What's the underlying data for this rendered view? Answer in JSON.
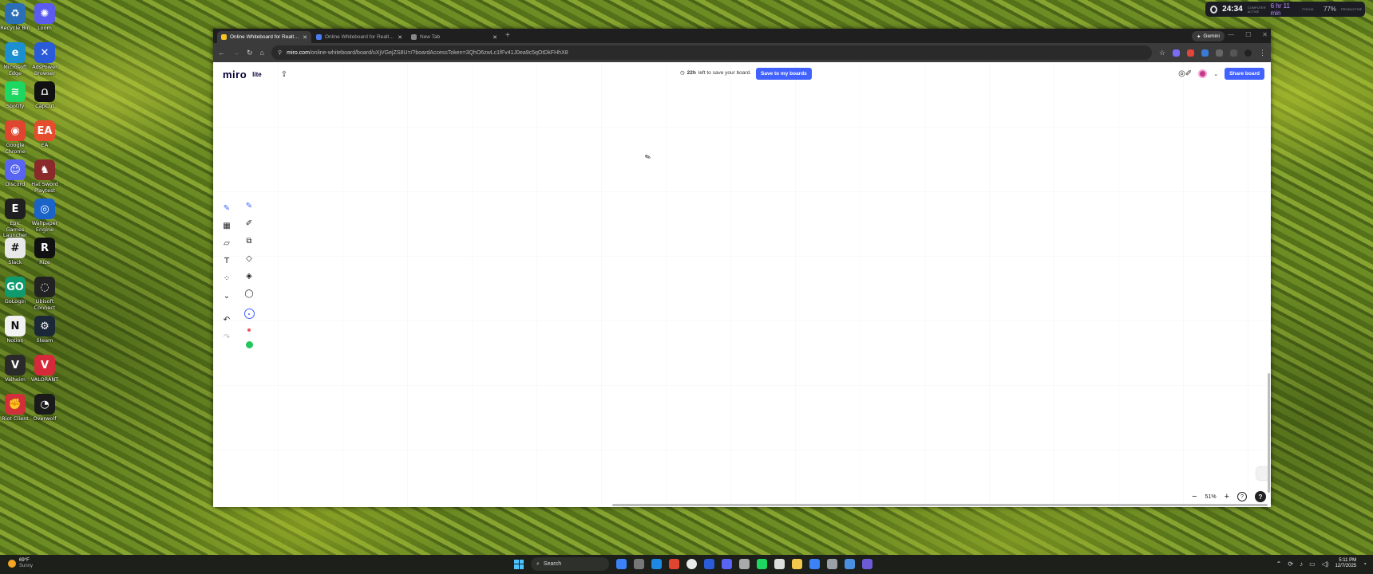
{
  "desktop": {
    "icons": [
      {
        "label": "Recycle Bin",
        "color": "#2a6fb8",
        "glyph": "♻"
      },
      {
        "label": "Loom",
        "color": "#5b5bf0",
        "glyph": "✺"
      },
      {
        "label": "Microsoft Edge",
        "color": "#1b8fd0",
        "glyph": "e"
      },
      {
        "label": "AdsPower Browser",
        "color": "#2a5bd8",
        "glyph": "✕"
      },
      {
        "label": "Spotify",
        "color": "#1ed760",
        "glyph": "≋"
      },
      {
        "label": "CapCut",
        "color": "#111111",
        "glyph": "⩍"
      },
      {
        "label": "Google Chrome",
        "color": "#e0452f",
        "glyph": "◉"
      },
      {
        "label": "EA",
        "color": "#e64d2d",
        "glyph": "EA"
      },
      {
        "label": "Discord",
        "color": "#5865f2",
        "glyph": "☺"
      },
      {
        "label": "Hat Sword Playtest",
        "color": "#8a2a2a",
        "glyph": "♞"
      },
      {
        "label": "Epic Games Launcher",
        "color": "#202020",
        "glyph": "E"
      },
      {
        "label": "Wallpaper Engine",
        "color": "#1a63c9",
        "glyph": "◎"
      },
      {
        "label": "Slack",
        "color": "#e8e8e8",
        "glyph": "#"
      },
      {
        "label": "Rize",
        "color": "#111111",
        "glyph": "R"
      },
      {
        "label": "GoLogin",
        "color": "#0f9b6e",
        "glyph": "GO"
      },
      {
        "label": "Ubisoft Connect",
        "color": "#222222",
        "glyph": "◌"
      },
      {
        "label": "Notion",
        "color": "#f2f2f2",
        "glyph": "N"
      },
      {
        "label": "Steam",
        "color": "#1b2838",
        "glyph": "⚙"
      },
      {
        "label": "Valheim",
        "color": "#2a2a2a",
        "glyph": "V"
      },
      {
        "label": "VALORANT",
        "color": "#d62a3a",
        "glyph": "V"
      },
      {
        "label": "Riot Client",
        "color": "#d1303a",
        "glyph": "✊"
      },
      {
        "label": "Overwolf",
        "color": "#1a1a1a",
        "glyph": "◔"
      }
    ]
  },
  "sys_widget": {
    "time": "24:34",
    "subtext": "COMPUTER ACTIVE",
    "duration": "6 hr 11 min",
    "duration_sub": "FOCUS",
    "percent": "77%",
    "percent_sub": "PRODUCTIVE"
  },
  "browser": {
    "tabs": [
      {
        "title": "Online Whiteboard for Realtime",
        "fav_color": "#f7c624",
        "active": true
      },
      {
        "title": "Online Whiteboard for Realtime",
        "fav_color": "#4a7cf0",
        "active": false
      },
      {
        "title": "New Tab",
        "fav_color": "#888888",
        "active": false
      }
    ],
    "new_tab": "+",
    "gemini_label": "Gemini",
    "url_domain": "miro.com",
    "url_path": "/online-whiteboard/board/uXjVGejZS8U=/?boardAccessToken=3QhO6zwLc1fFv41J0ea9c5qOtDkFHhX8",
    "window_controls": [
      "—",
      "☐",
      "✕"
    ]
  },
  "miro": {
    "logo": "miro",
    "lite": "lite",
    "save_time_bold": "22h",
    "save_time_text": "left to save your board.",
    "save_button": "Save to my boards",
    "share_button": "Share board",
    "zoom": "51%",
    "zoom_out": "−",
    "zoom_in": "+",
    "help_outline": "?",
    "help_filled": "?",
    "left_tools": [
      {
        "name": "pen-tool-icon",
        "glyph": "✎",
        "active": true
      },
      {
        "name": "frame-tool-icon",
        "glyph": "▦",
        "active": false
      },
      {
        "name": "sticky-note-icon",
        "glyph": "▱",
        "active": false
      },
      {
        "name": "text-tool-icon",
        "glyph": "T",
        "active": false
      },
      {
        "name": "more-apps-icon",
        "glyph": "⁘",
        "active": false
      },
      {
        "name": "expand-more-icon",
        "glyph": "⌄",
        "active": false
      },
      {
        "name": "undo-icon",
        "glyph": "↶",
        "active": false
      },
      {
        "name": "redo-icon",
        "glyph": "↷",
        "active": false
      }
    ],
    "sub_tools": [
      {
        "name": "pen-icon",
        "glyph": "✎"
      },
      {
        "name": "highlighter-icon",
        "glyph": "✐"
      },
      {
        "name": "smart-drawing-icon",
        "glyph": "⧉"
      },
      {
        "name": "eraser-icon",
        "glyph": "◇"
      },
      {
        "name": "object-eraser-icon",
        "glyph": "◈"
      },
      {
        "name": "lasso-icon",
        "glyph": "◯"
      }
    ],
    "colors": {
      "accent": "#4262ff",
      "red": "#f04f5a",
      "green": "#22c55e"
    }
  },
  "taskbar": {
    "weather_temp": "69°F",
    "weather_desc": "Sunny",
    "search_label": "Search",
    "apps": [
      "#3b82f6",
      "#777777",
      "#1e88e5",
      "#e0452f",
      "#eaeaea",
      "#2a5bd8",
      "#5865f2",
      "#aaaaaa",
      "#1ed760",
      "#dddddd",
      "#f2c94c",
      "#3b82f6",
      "#9aa0a6",
      "#4a90e2",
      "#6b5bd6"
    ],
    "time": "5:11 PM",
    "date": "12/7/2025"
  }
}
